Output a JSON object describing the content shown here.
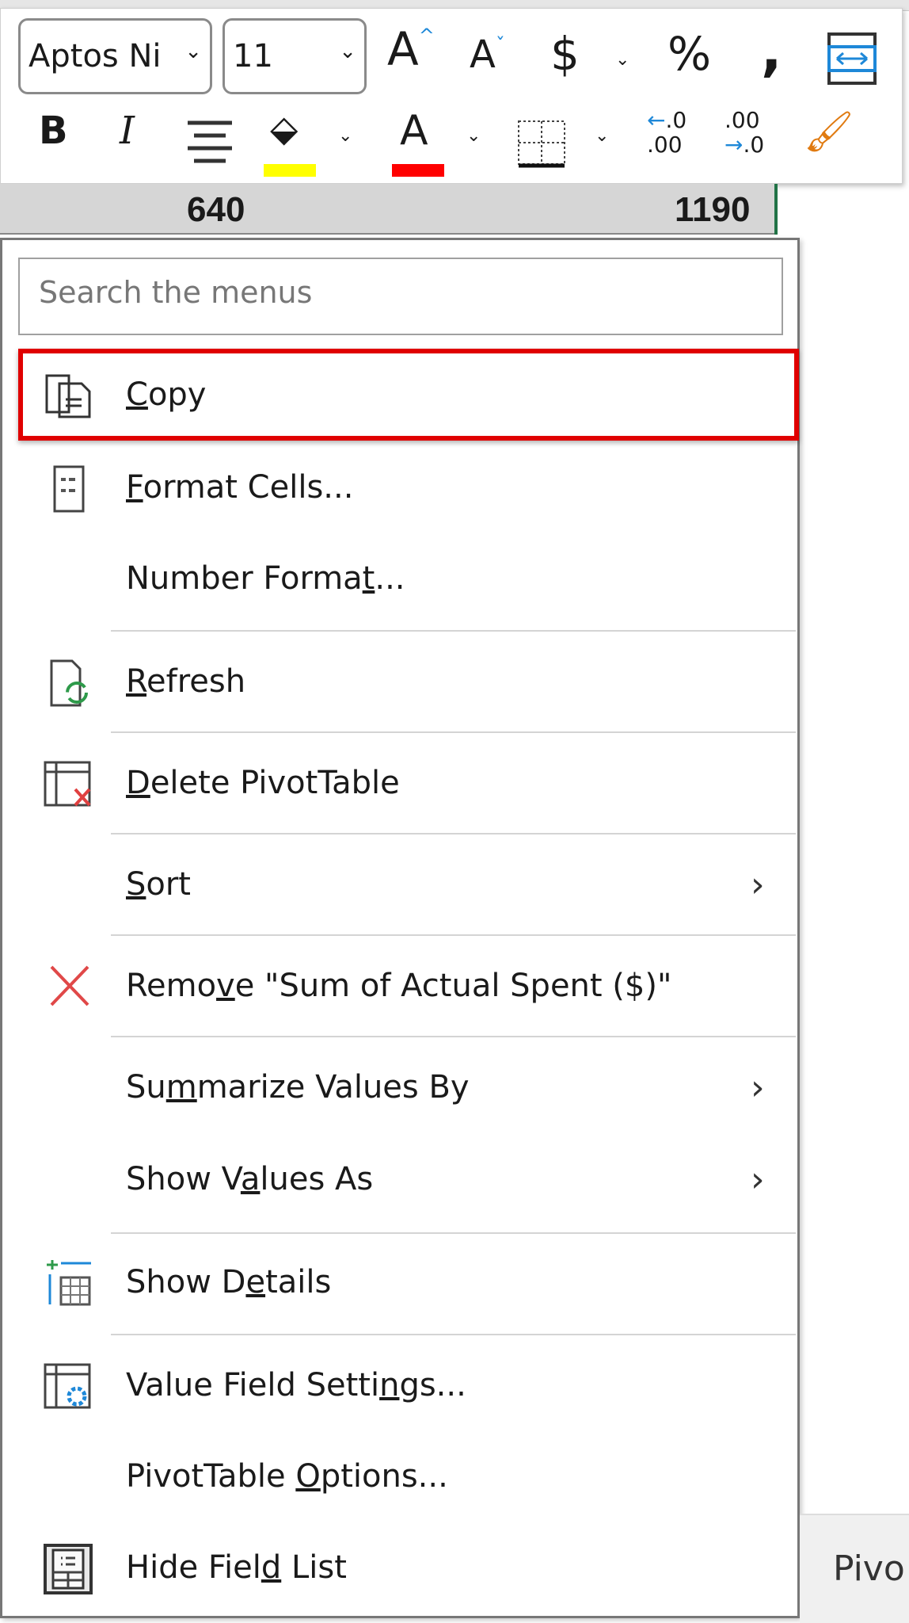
{
  "toolbar": {
    "font_name": "Aptos Ni",
    "font_size": "11",
    "icons": [
      "increase-font-size",
      "decrease-font-size",
      "currency",
      "percent",
      "comma-style",
      "wrap-text",
      "bold",
      "italic",
      "center-align",
      "fill-color",
      "font-color",
      "borders",
      "increase-decimal",
      "decrease-decimal",
      "format-painter"
    ],
    "fill_color": "#ffff00",
    "font_color": "#ff0000"
  },
  "cells": {
    "value_1": "640",
    "value_2": "1190"
  },
  "menu": {
    "search_placeholder": "Search the menus",
    "items": [
      {
        "pre": "",
        "key": "C",
        "post": "opy",
        "icon": "copy-icon",
        "highlighted": true
      },
      {
        "pre": "",
        "key": "F",
        "post": "ormat Cells...",
        "icon": "format-cells-icon"
      },
      {
        "pre": "Number Forma",
        "key": "t",
        "post": "...",
        "icon": ""
      },
      {
        "pre": "",
        "key": "R",
        "post": "efresh",
        "icon": "refresh-icon"
      },
      {
        "pre": "",
        "key": "D",
        "post": "elete PivotTable",
        "icon": "delete-pivottable-icon"
      },
      {
        "pre": "",
        "key": "S",
        "post": "ort",
        "icon": "",
        "submenu": true
      },
      {
        "pre": "Remo",
        "key": "v",
        "post": "e \"Sum of Actual Spent ($)\"",
        "icon": "remove-x-icon"
      },
      {
        "pre": "Su",
        "key": "m",
        "post": "marize Values By",
        "icon": "",
        "submenu": true
      },
      {
        "pre": "Show V",
        "key": "a",
        "post": "lues As",
        "icon": "",
        "submenu": true
      },
      {
        "pre": "Show D",
        "key": "e",
        "post": "tails",
        "icon": "show-details-icon"
      },
      {
        "pre": "Value Field Setti",
        "key": "n",
        "post": "gs...",
        "icon": "value-field-settings-icon"
      },
      {
        "pre": "PivotTable ",
        "key": "O",
        "post": "ptions...",
        "icon": ""
      },
      {
        "pre": "Hide Fiel",
        "key": "d",
        "post": " List",
        "icon": "field-list-icon"
      }
    ]
  },
  "status": {
    "tab_partial": "Pivo"
  },
  "colors": {
    "highlight_border": "#e00000",
    "accent_blue": "#1e88d8"
  }
}
